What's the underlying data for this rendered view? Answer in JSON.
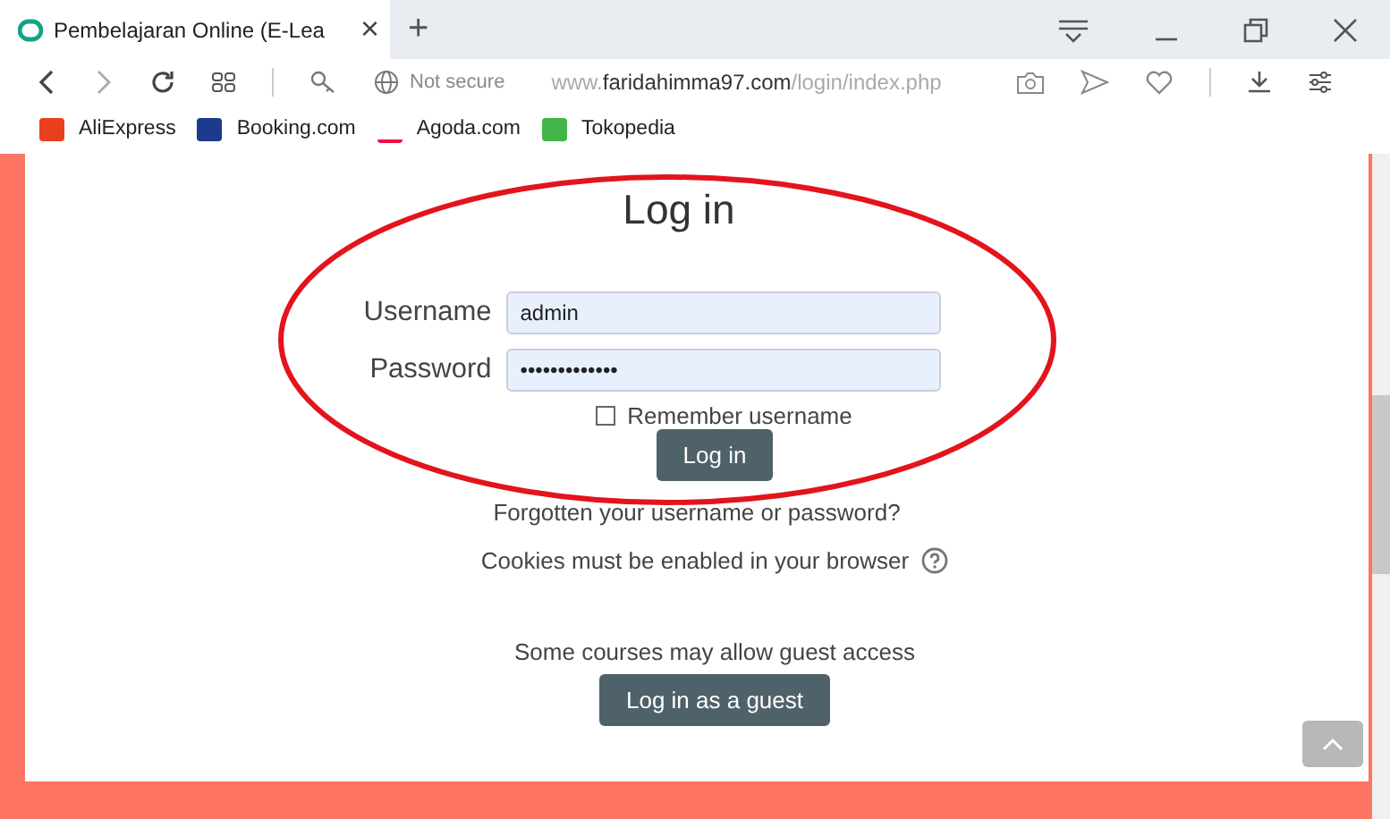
{
  "browser": {
    "tab": {
      "title": "Pembelajaran Online (E-Lea",
      "close": "×"
    },
    "new_tab": "+",
    "security": "Not secure",
    "url": {
      "prefix": "www.",
      "domain": "faridahimma97.com",
      "path": "/login/index.php"
    },
    "bookmarks": [
      {
        "label": "AliExpress",
        "color": "#e8401c"
      },
      {
        "label": "Booking.com",
        "color": "#1b3b8c"
      },
      {
        "label": "Agoda.com",
        "color": "#ffffff"
      },
      {
        "label": "Tokopedia",
        "color": "#42b549"
      }
    ]
  },
  "login": {
    "title": "Log in",
    "fields": [
      {
        "label": "Username",
        "value": "admin"
      },
      {
        "label": "Password",
        "value": "•••••••••••••"
      }
    ],
    "remember": {
      "label": "Remember username",
      "checked": false
    },
    "submit": "Log in",
    "forgot": "Forgotten your username or password?",
    "cookies": "Cookies must be enabled in your browser",
    "guest_note": "Some courses may allow guest access",
    "guest_button": "Log in as a guest"
  }
}
